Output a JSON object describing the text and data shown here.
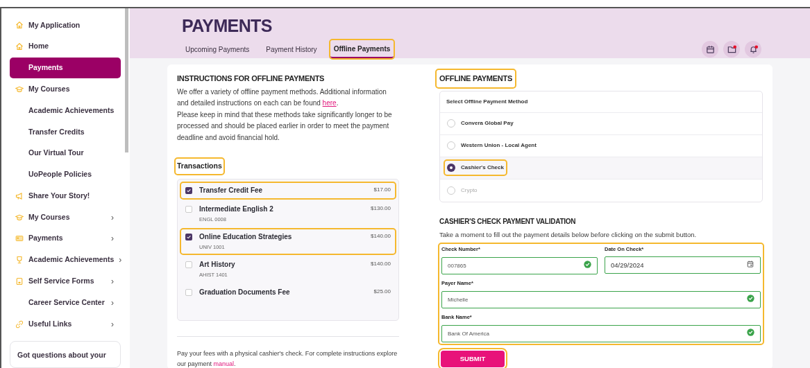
{
  "sidebar": {
    "items": [
      {
        "label": "My Application",
        "kind": "home",
        "selected": false
      },
      {
        "label": "Home",
        "kind": "home",
        "selected": false
      },
      {
        "label": "Payments",
        "kind": "plain",
        "selected": true
      },
      {
        "label": "My Courses",
        "kind": "cap",
        "selected": false
      },
      {
        "label": "Academic Achievements",
        "kind": "plain",
        "selected": false
      },
      {
        "label": "Transfer Credits",
        "kind": "plain",
        "selected": false
      },
      {
        "label": "Our Virtual Tour",
        "kind": "plain",
        "selected": false
      },
      {
        "label": "UoPeople Policies",
        "kind": "plain",
        "selected": false
      },
      {
        "label": "Share Your Story!",
        "kind": "megaphone",
        "selected": false
      },
      {
        "label": "My Courses",
        "kind": "cap",
        "selected": false,
        "chevron": "›"
      },
      {
        "label": "Payments",
        "kind": "card",
        "selected": false,
        "chevron": "›"
      },
      {
        "label": "Academic Achievements",
        "kind": "trophy",
        "selected": false,
        "chevron": "›"
      },
      {
        "label": "Self Service Forms",
        "kind": "forms",
        "selected": false,
        "chevron": "›"
      },
      {
        "label": "Career Service Center",
        "kind": "plain",
        "selected": false,
        "chevron": "›"
      },
      {
        "label": "Useful Links",
        "kind": "link",
        "selected": false,
        "chevron": "›"
      }
    ],
    "help_card": "Got questions about your"
  },
  "header": {
    "title": "PAYMENTS",
    "tabs": [
      {
        "label": "Upcoming Payments",
        "selected": false,
        "highlighted": false
      },
      {
        "label": "Payment History",
        "selected": false,
        "highlighted": false
      },
      {
        "label": "Offline Payments",
        "selected": true,
        "highlighted": true
      }
    ],
    "icons": [
      {
        "kind": "calendar",
        "badge": false
      },
      {
        "kind": "folder",
        "badge": true
      },
      {
        "kind": "bell",
        "badge": true
      }
    ]
  },
  "instructions": {
    "title": "INSTRUCTIONS FOR OFFLINE PAYMENTS",
    "paragraph_1": "We offer a variety of offline payment methods. Additional information and detailed instructions on each can be found ",
    "link": "here",
    "paragraph_1_end": ".",
    "paragraph_2": "Please keep in mind that these methods take significantly longer to be processed and should be placed earlier in order to meet the payment deadline and avoid financial hold."
  },
  "transactions": {
    "title": "Transactions",
    "highlighted": true,
    "items": [
      {
        "name": "Transfer Credit Fee",
        "amount": "$17.00",
        "checked": true,
        "highlighted": true
      },
      {
        "name": "Intermediate English 2",
        "code": "ENGL 0008",
        "amount": "$130.00",
        "checked": false,
        "highlighted": false
      },
      {
        "name": "Online Education Strategies",
        "code": "UNIV 1001",
        "amount": "$140.00",
        "checked": true,
        "highlighted": true
      },
      {
        "name": "Art History",
        "code": "AHIST 1401",
        "amount": "$140.00",
        "checked": false,
        "highlighted": false
      },
      {
        "name": "Graduation Documents Fee",
        "amount": "$25.00",
        "checked": false,
        "highlighted": false
      }
    ]
  },
  "footer_note": {
    "text": "Pay your fees with a physical cashier's check. For complete instructions explore our payment ",
    "link": "manual",
    "end": "."
  },
  "offline_payments": {
    "title": "OFFLINE PAYMENTS",
    "highlighted": true,
    "prompt": "Select Offline Payment Method",
    "methods": [
      {
        "label": "Convera Global Pay",
        "selected": false,
        "disabled": false,
        "highlighted": false
      },
      {
        "label": "Western Union - Local Agent",
        "selected": false,
        "disabled": false,
        "highlighted": false
      },
      {
        "label": "Cashier's Check",
        "selected": true,
        "disabled": false,
        "highlighted": true
      },
      {
        "label": "Crypto",
        "selected": false,
        "disabled": true,
        "highlighted": false
      }
    ]
  },
  "validation": {
    "title": "CASHIER'S CHECK PAYMENT VALIDATION",
    "description": "Take a moment to fill out the payment details below before clicking on the submit button.",
    "highlighted": true,
    "fields": [
      {
        "label": "Check Number*",
        "value": "007865",
        "kind": "text",
        "valid": true
      },
      {
        "label": "Date On Check*",
        "value": "04/29/2024",
        "kind": "date",
        "valid": true
      },
      {
        "label": "Payer Name*",
        "value": "Michelle",
        "kind": "text",
        "valid": true
      },
      {
        "label": "Bank Name*",
        "value": "Bank Of America",
        "kind": "text",
        "valid": true
      }
    ],
    "submit": {
      "label": "SUBMIT",
      "highlighted": true
    }
  }
}
